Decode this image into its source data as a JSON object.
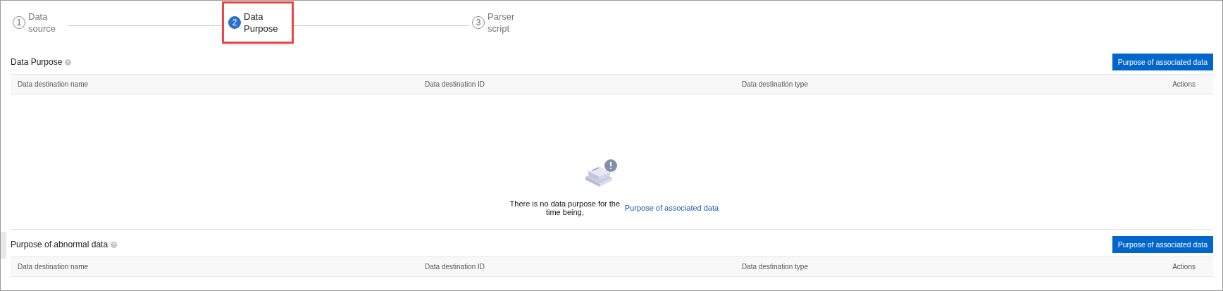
{
  "steps": [
    {
      "number": "1",
      "label": "Data source",
      "selected": false,
      "highlighted": false
    },
    {
      "number": "2",
      "label": "Data Purpose",
      "selected": true,
      "highlighted": true
    },
    {
      "number": "3",
      "label": "Parser script",
      "selected": false,
      "highlighted": false
    }
  ],
  "sections": [
    {
      "title": "Data Purpose",
      "button": "Purpose of associated data",
      "columns": [
        "Data destination name",
        "Data destination ID",
        "Data destination type",
        "Actions"
      ],
      "empty": {
        "message": "There is no data purpose for the time being,",
        "link": "Purpose of associated data"
      }
    },
    {
      "title": "Purpose of abnormal data",
      "button": "Purpose of associated data",
      "columns": [
        "Data destination name",
        "Data destination ID",
        "Data destination type",
        "Actions"
      ]
    }
  ]
}
